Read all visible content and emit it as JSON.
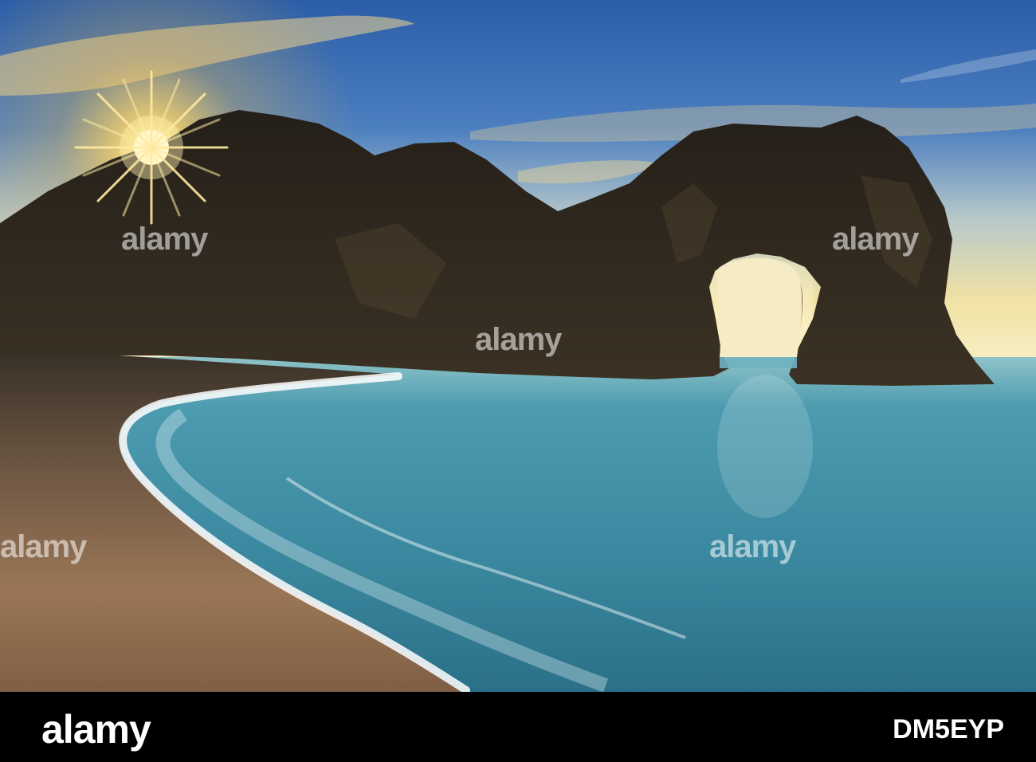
{
  "image": {
    "subject": "photo",
    "watermark": "alamy",
    "colors": {
      "sky_top": "#2c5fa6",
      "sky_horizon": "#f3e6a6",
      "sun": "#fff6c8",
      "rock": "#2a241c",
      "sea": "#3f8ea3",
      "sea_deep": "#1e5c74",
      "beach": "#8c6b4c",
      "foam": "#ffffff"
    }
  },
  "footer": {
    "logo": "alamy",
    "image_id": "DM5EYP"
  }
}
